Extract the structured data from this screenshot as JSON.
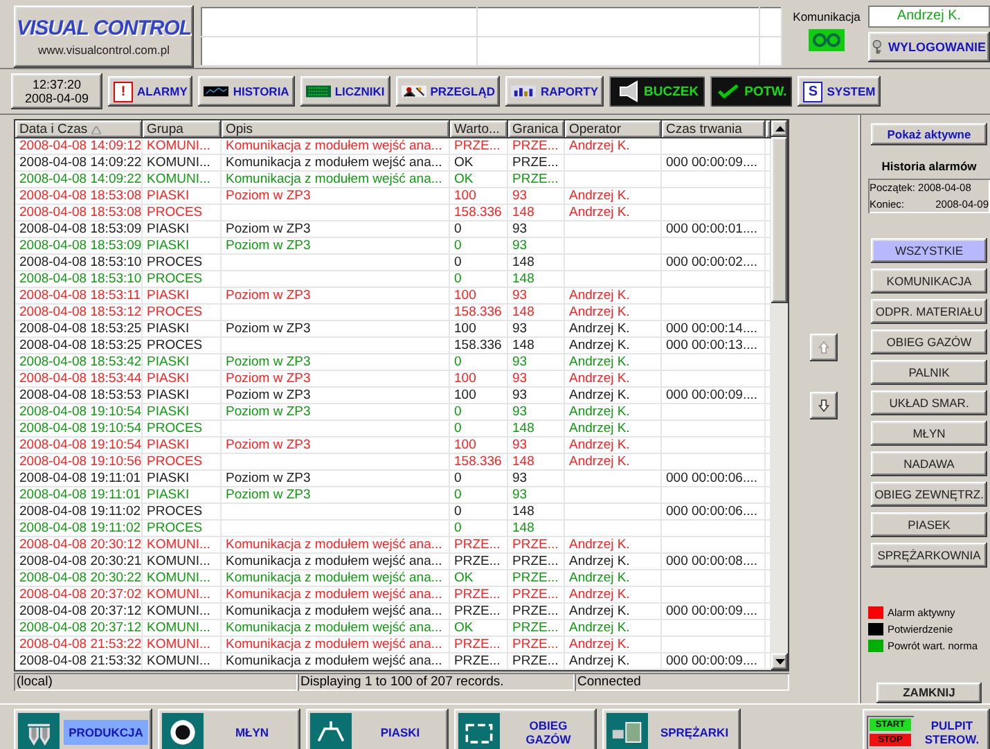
{
  "header": {
    "logo": "VISUAL CONTROL",
    "website": "www.visualcontrol.com.pl",
    "communication_label": "Komunikacja",
    "user": "Andrzej K.",
    "logout_button": "WYLOGOWANIE"
  },
  "toolbar": {
    "time": "12:37:20",
    "date": "2008-04-09",
    "buttons": [
      {
        "label": "ALARMY",
        "kind": "normal",
        "glyph": "!"
      },
      {
        "label": "HISTORIA",
        "kind": "normal"
      },
      {
        "label": "LICZNIKI",
        "kind": "normal"
      },
      {
        "label": "PRZEGLĄD",
        "kind": "normal"
      },
      {
        "label": "RAPORTY",
        "kind": "normal"
      },
      {
        "label": "BUCZEK",
        "kind": "dark"
      },
      {
        "label": "POTW.",
        "kind": "dark"
      },
      {
        "label": "SYSTEM",
        "kind": "normal",
        "glyph": "S"
      }
    ]
  },
  "table": {
    "columns": [
      "Data i Czas",
      "Grupa",
      "Opis",
      "Warto...",
      "Granica",
      "Operator",
      "Czas trwania"
    ],
    "rows": [
      {
        "time": "2008-04-08 14:09:12",
        "group": "KOMUNI...",
        "description": "Komunikacja z modułem wejść ana...",
        "value": "PRZE...",
        "limit": "PRZE...",
        "operator": "Andrzej K.",
        "color": "#ff2020"
      },
      {
        "time": "2008-04-08 14:09:22",
        "group": "KOMUNI...",
        "description": "Komunikacja z modułem wejść ana...",
        "value": "OK",
        "limit": "PRZE...",
        "duration": "000 00:00:09....",
        "color": "#202020"
      },
      {
        "time": "2008-04-08 14:09:22",
        "group": "KOMUNI...",
        "description": "Komunikacja z modułem wejść ana...",
        "value": "OK",
        "limit": "PRZE...",
        "color": "#109a10"
      },
      {
        "time": "2008-04-08 18:53:08",
        "group": "PIASKI",
        "description": "Poziom w ZP3",
        "value": "100",
        "limit": "93",
        "operator": "Andrzej K.",
        "color": "#ff2020"
      },
      {
        "time": "2008-04-08 18:53:08",
        "group": "PROCES",
        "value": "158.336",
        "limit": "148",
        "operator": "Andrzej K.",
        "color": "#ff2020"
      },
      {
        "time": "2008-04-08 18:53:09",
        "group": "PIASKI",
        "description": "Poziom w ZP3",
        "value": "0",
        "limit": "93",
        "duration": "000 00:00:01....",
        "color": "#202020"
      },
      {
        "time": "2008-04-08 18:53:09",
        "group": "PIASKI",
        "description": "Poziom w ZP3",
        "value": "0",
        "limit": "93",
        "color": "#109a10"
      },
      {
        "time": "2008-04-08 18:53:10",
        "group": "PROCES",
        "value": "0",
        "limit": "148",
        "duration": "000 00:00:02....",
        "color": "#202020"
      },
      {
        "time": "2008-04-08 18:53:10",
        "group": "PROCES",
        "value": "0",
        "limit": "148",
        "color": "#109a10"
      },
      {
        "time": "2008-04-08 18:53:11",
        "group": "PIASKI",
        "description": "Poziom w ZP3",
        "value": "100",
        "limit": "93",
        "operator": "Andrzej K.",
        "color": "#ff2020"
      },
      {
        "time": "2008-04-08 18:53:12",
        "group": "PROCES",
        "value": "158.336",
        "limit": "148",
        "operator": "Andrzej K.",
        "color": "#ff2020"
      },
      {
        "time": "2008-04-08 18:53:25",
        "group": "PIASKI",
        "description": "Poziom w ZP3",
        "value": "100",
        "limit": "93",
        "operator": "Andrzej K.",
        "duration": "000 00:00:14....",
        "color": "#202020"
      },
      {
        "time": "2008-04-08 18:53:25",
        "group": "PROCES",
        "value": "158.336",
        "limit": "148",
        "operator": "Andrzej K.",
        "duration": "000 00:00:13....",
        "color": "#202020"
      },
      {
        "time": "2008-04-08 18:53:42",
        "group": "PIASKI",
        "description": "Poziom w ZP3",
        "value": "0",
        "limit": "93",
        "operator": "Andrzej K.",
        "color": "#109a10"
      },
      {
        "time": "2008-04-08 18:53:44",
        "group": "PIASKI",
        "description": "Poziom w ZP3",
        "value": "100",
        "limit": "93",
        "operator": "Andrzej K.",
        "color": "#ff2020"
      },
      {
        "time": "2008-04-08 18:53:53",
        "group": "PIASKI",
        "description": "Poziom w ZP3",
        "value": "100",
        "limit": "93",
        "operator": "Andrzej K.",
        "duration": "000 00:00:09....",
        "color": "#202020"
      },
      {
        "time": "2008-04-08 19:10:54",
        "group": "PIASKI",
        "description": "Poziom w ZP3",
        "value": "0",
        "limit": "93",
        "operator": "Andrzej K.",
        "color": "#109a10"
      },
      {
        "time": "2008-04-08 19:10:54",
        "group": "PROCES",
        "value": "0",
        "limit": "148",
        "operator": "Andrzej K.",
        "color": "#109a10"
      },
      {
        "time": "2008-04-08 19:10:54",
        "group": "PIASKI",
        "description": "Poziom w ZP3",
        "value": "100",
        "limit": "93",
        "operator": "Andrzej K.",
        "color": "#ff2020"
      },
      {
        "time": "2008-04-08 19:10:56",
        "group": "PROCES",
        "value": "158.336",
        "limit": "148",
        "operator": "Andrzej K.",
        "color": "#ff2020"
      },
      {
        "time": "2008-04-08 19:11:01",
        "group": "PIASKI",
        "description": "Poziom w ZP3",
        "value": "0",
        "limit": "93",
        "duration": "000 00:00:06....",
        "color": "#202020"
      },
      {
        "time": "2008-04-08 19:11:01",
        "group": "PIASKI",
        "description": "Poziom w ZP3",
        "value": "0",
        "limit": "93",
        "color": "#109a10"
      },
      {
        "time": "2008-04-08 19:11:02",
        "group": "PROCES",
        "value": "0",
        "limit": "148",
        "duration": "000 00:00:06....",
        "color": "#202020"
      },
      {
        "time": "2008-04-08 19:11:02",
        "group": "PROCES",
        "value": "0",
        "limit": "148",
        "color": "#109a10"
      },
      {
        "time": "2008-04-08 20:30:12",
        "group": "KOMUNI...",
        "description": "Komunikacja z modułem wejść ana...",
        "value": "PRZE...",
        "limit": "PRZE...",
        "operator": "Andrzej K.",
        "color": "#ff2020"
      },
      {
        "time": "2008-04-08 20:30:21",
        "group": "KOMUNI...",
        "description": "Komunikacja z modułem wejść ana...",
        "value": "PRZE...",
        "limit": "PRZE...",
        "operator": "Andrzej K.",
        "duration": "000 00:00:08....",
        "color": "#202020"
      },
      {
        "time": "2008-04-08 20:30:22",
        "group": "KOMUNI...",
        "description": "Komunikacja z modułem wejść ana...",
        "value": "OK",
        "limit": "PRZE...",
        "operator": "Andrzej K.",
        "color": "#109a10"
      },
      {
        "time": "2008-04-08 20:37:02",
        "group": "KOMUNI...",
        "description": "Komunikacja z modułem wejść ana...",
        "value": "PRZE...",
        "limit": "PRZE...",
        "operator": "Andrzej K.",
        "color": "#ff2020"
      },
      {
        "time": "2008-04-08 20:37:12",
        "group": "KOMUNI...",
        "description": "Komunikacja z modułem wejść ana...",
        "value": "PRZE...",
        "limit": "PRZE...",
        "operator": "Andrzej K.",
        "duration": "000 00:00:09....",
        "color": "#202020"
      },
      {
        "time": "2008-04-08 20:37:12",
        "group": "KOMUNI...",
        "description": "Komunikacja z modułem wejść ana...",
        "value": "OK",
        "limit": "PRZE...",
        "operator": "Andrzej K.",
        "color": "#109a10"
      },
      {
        "time": "2008-04-08 21:53:22",
        "group": "KOMUNI...",
        "description": "Komunikacja z modułem wejść ana...",
        "value": "PRZE...",
        "limit": "PRZE...",
        "operator": "Andrzej K.",
        "color": "#ff2020"
      },
      {
        "time": "2008-04-08 21:53:32",
        "group": "KOMUNI...",
        "description": "Komunikacja z modułem wejść ana...",
        "value": "PRZE...",
        "limit": "PRZE...",
        "operator": "Andrzej K.",
        "duration": "000 00:00:09....",
        "color": "#202020"
      }
    ]
  },
  "status_bar": [
    "(local)",
    "Displaying 1 to 100 of 207 records.",
    "Connected"
  ],
  "side_panel": {
    "show_active_button": "Pokaż aktywne",
    "title": "Historia alarmów",
    "start": "Początek: 2008-04-08",
    "end_label": "Koniec:",
    "end_date": "2008-04-09",
    "filters": [
      {
        "label": "WSZYSTKIE",
        "selected": true
      },
      {
        "label": "KOMUNIKACJA",
        "selected": false
      },
      {
        "label": "ODPR. MATERIAŁU",
        "selected": false
      },
      {
        "label": "OBIEG GAZÓW",
        "selected": false
      },
      {
        "label": "PALNIK",
        "selected": false
      },
      {
        "label": "UKŁAD SMAR.",
        "selected": false
      },
      {
        "label": "MŁYN",
        "selected": false
      },
      {
        "label": "NADAWA",
        "selected": false
      },
      {
        "label": "OBIEG ZEWNĘTRZ.",
        "selected": false
      },
      {
        "label": "PIASEK",
        "selected": false
      },
      {
        "label": "SPRĘŻARKOWNIA",
        "selected": false
      }
    ],
    "legend": [
      {
        "label": "Alarm aktywny",
        "color": "#ff0000"
      },
      {
        "label": "Potwierdzenie",
        "color": "#000000"
      },
      {
        "label": "Powrót wart. norma",
        "color": "#00b000"
      }
    ],
    "close_button": "ZAMKNIJ"
  },
  "nav": [
    {
      "label": "PRODUKCJA",
      "selected": true
    },
    {
      "label": "MŁYN",
      "selected": false
    },
    {
      "label": "PIASKI",
      "selected": false
    },
    {
      "label": "OBIEG GAZÓW",
      "selected": false
    },
    {
      "label": "SPRĘŻARKI",
      "selected": false
    },
    {
      "label": "PULPIT STEROW.",
      "selected": false,
      "start": "START",
      "stop": "STOP"
    }
  ]
}
